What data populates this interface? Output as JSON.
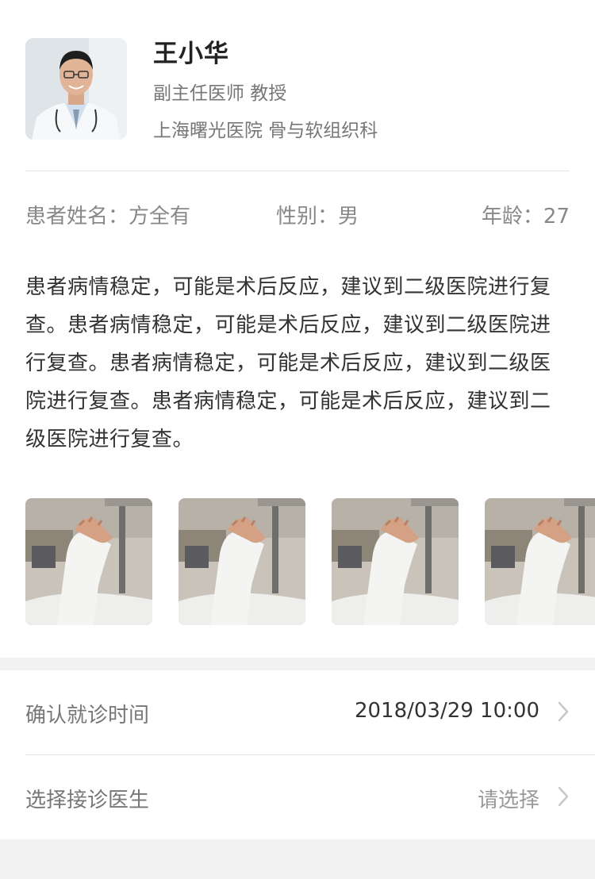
{
  "doctor": {
    "name": "王小华",
    "title": "副主任医师 教授",
    "hospital": "上海曙光医院 骨与软组织科"
  },
  "patient": {
    "name_text": "患者姓名：方全有",
    "gender_text": "性别：男",
    "age_text": "年龄：27"
  },
  "description": "患者病情稳定，可能是术后反应，建议到二级医院进行复查。患者病情稳定，可能是术后反应，建议到二级医院进行复查。患者病情稳定，可能是术后反应，建议到二级医院进行复查。患者病情稳定，可能是术后反应，建议到二级医院进行复查。",
  "photos": [
    "cast-photo",
    "cast-photo",
    "cast-photo",
    "cast-photo"
  ],
  "rows": [
    {
      "label": "确认就诊时间",
      "value": "2018/03/29 10:00"
    },
    {
      "label": "选择接诊医生",
      "value": "请选择"
    }
  ],
  "colors": {
    "divider": "#e3e3e3",
    "band": "#f2f2f2",
    "muted": "#777777"
  }
}
